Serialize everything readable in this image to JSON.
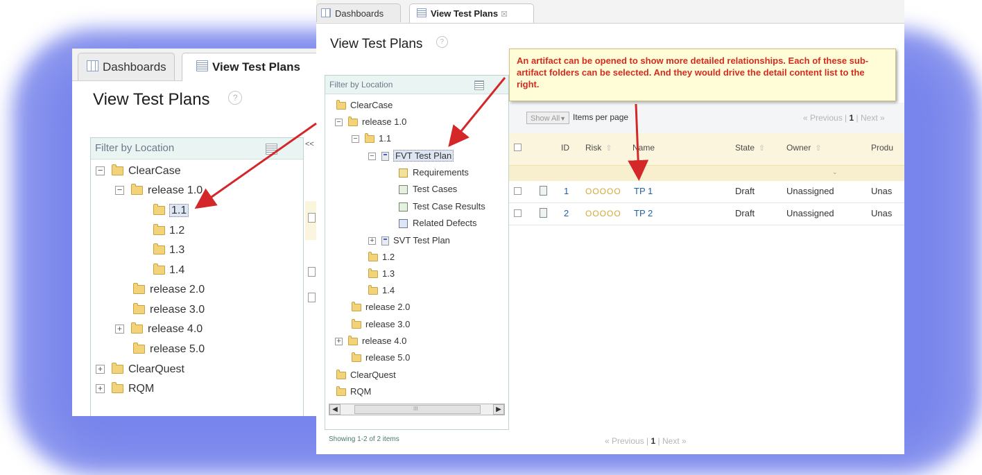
{
  "back": {
    "tabs": [
      {
        "label": "Dashboards"
      },
      {
        "label": "View Test Plans"
      }
    ],
    "title": "View Test Plans",
    "help": "?",
    "filter_label": "Filter by Location",
    "collapse": "<<",
    "tree": [
      {
        "label": "ClearCase"
      },
      {
        "label": "release 1.0"
      },
      {
        "label": "1.1"
      },
      {
        "label": "1.2"
      },
      {
        "label": "1.3"
      },
      {
        "label": "1.4"
      },
      {
        "label": "release 2.0"
      },
      {
        "label": "release 3.0"
      },
      {
        "label": "release 4.0"
      },
      {
        "label": "release 5.0"
      },
      {
        "label": "ClearQuest"
      },
      {
        "label": "RQM"
      }
    ]
  },
  "front": {
    "tabs": [
      {
        "label": "Dashboards"
      },
      {
        "label": "View Test Plans"
      }
    ],
    "tab_close": "☒",
    "title": "View Test Plans",
    "help": "?",
    "filter_label": "Filter by Location",
    "tree": [
      {
        "label": "ClearCase"
      },
      {
        "label": "release 1.0"
      },
      {
        "label": "1.1"
      },
      {
        "label": "FVT Test Plan"
      },
      {
        "label": "Requirements"
      },
      {
        "label": "Test Cases"
      },
      {
        "label": "Test Case Results"
      },
      {
        "label": "Related Defects"
      },
      {
        "label": "SVT Test Plan"
      },
      {
        "label": "1.2"
      },
      {
        "label": "1.3"
      },
      {
        "label": "1.4"
      },
      {
        "label": "release 2.0"
      },
      {
        "label": "release 3.0"
      },
      {
        "label": "release 4.0"
      },
      {
        "label": "release 5.0"
      },
      {
        "label": "ClearQuest"
      },
      {
        "label": "RQM"
      }
    ],
    "scroll_grip": "III",
    "callout": "An artifact can be opened to show more detailed relationships. Each of these sub-artifact folders can be selected. And they would drive the detail content list to the right.",
    "toolbar": {
      "show_all": "Show All",
      "items_per_page": "Items per page",
      "pager_prev": "« Previous |",
      "pager_page": "1",
      "pager_next": "| Next »"
    },
    "columns": {
      "id": "ID",
      "risk": "Risk",
      "name": "Name",
      "state": "State",
      "owner": "Owner",
      "product": "Produ"
    },
    "rows": [
      {
        "id": "1",
        "risk": "OOOOO",
        "name": "TP 1",
        "state": "Draft",
        "owner": "Unassigned",
        "product": "Unas"
      },
      {
        "id": "2",
        "risk": "OOOOO",
        "name": "TP 2",
        "state": "Draft",
        "owner": "Unassigned",
        "product": "Unas"
      }
    ],
    "showing": "Showing 1-2 of 2 items",
    "bottom_pager": {
      "prev": "« Previous |",
      "page": "1",
      "next": "| Next »"
    }
  },
  "colors": {
    "arrow": "#d4272a",
    "callout_bg": "#fffdd8",
    "callout_text": "#d32c1f",
    "glow": "#8a95ee",
    "header_bg": "#fbf5dd"
  }
}
